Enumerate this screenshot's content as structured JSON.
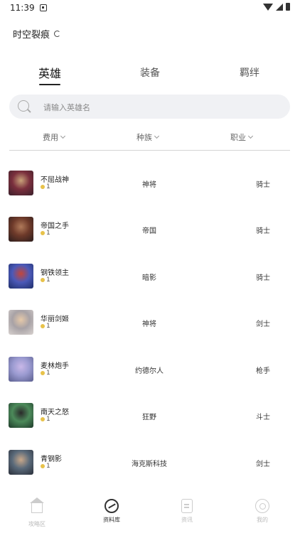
{
  "status_bar": {
    "time": "11:39"
  },
  "header": {
    "title": "时空裂痕"
  },
  "tabs": [
    {
      "label": "英雄",
      "active": true
    },
    {
      "label": "装备",
      "active": false
    },
    {
      "label": "羁绊",
      "active": false
    }
  ],
  "search": {
    "placeholder": "请输入英雄名"
  },
  "filters": [
    {
      "label": "费用"
    },
    {
      "label": "种族"
    },
    {
      "label": "职业"
    }
  ],
  "heroes": [
    {
      "name": "不屈战神",
      "cost": "1",
      "race": "神将",
      "job": "骑士",
      "avatar_colors": [
        "#3a1f2a",
        "#7a2f3d",
        "#c9a27a"
      ]
    },
    {
      "name": "帝国之手",
      "cost": "1",
      "race": "帝国",
      "job": "骑士",
      "avatar_colors": [
        "#2a1c1c",
        "#6e3a2a",
        "#b07a5a"
      ]
    },
    {
      "name": "钢铁领主",
      "cost": "1",
      "race": "暗影",
      "job": "骑士",
      "avatar_colors": [
        "#1f2f6a",
        "#4b59b8",
        "#c4463a"
      ]
    },
    {
      "name": "华丽剑姬",
      "cost": "1",
      "race": "神将",
      "job": "剑士",
      "avatar_colors": [
        "#d8d2cf",
        "#a8a2a6",
        "#e6c9a9"
      ]
    },
    {
      "name": "麦林炮手",
      "cost": "1",
      "race": "约德尔人",
      "job": "枪手",
      "avatar_colors": [
        "#5a5e8e",
        "#9a9ad0",
        "#c9b8e8"
      ]
    },
    {
      "name": "南天之怒",
      "cost": "1",
      "race": "狂野",
      "job": "斗士",
      "avatar_colors": [
        "#1e3a2a",
        "#4c8a5a",
        "#2a2a2a"
      ]
    },
    {
      "name": "青钢影",
      "cost": "1",
      "race": "海克斯科技",
      "job": "剑士",
      "avatar_colors": [
        "#2a2f3a",
        "#5a6a7a",
        "#c9a88a"
      ]
    }
  ],
  "bottom_nav": [
    {
      "label": "攻略区",
      "icon": "home-icon",
      "active": false
    },
    {
      "label": "资料库",
      "icon": "library-icon",
      "active": true
    },
    {
      "label": "资讯",
      "icon": "news-icon",
      "active": false
    },
    {
      "label": "我的",
      "icon": "me-icon",
      "active": false
    }
  ]
}
